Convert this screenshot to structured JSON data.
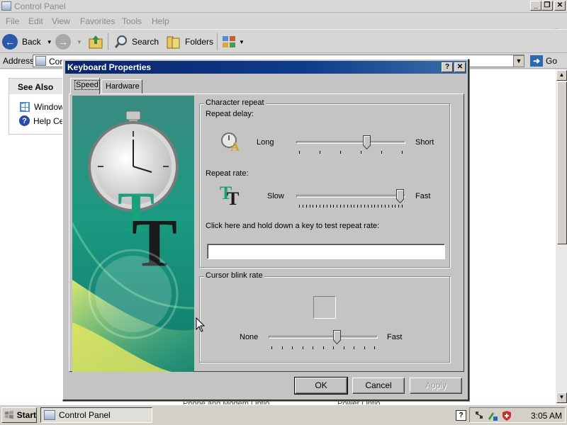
{
  "control_panel": {
    "title": "Control Panel",
    "menu": [
      "File",
      "Edit",
      "View",
      "Favorites",
      "Tools",
      "Help"
    ],
    "toolbar": {
      "back": "Back",
      "search": "Search",
      "folders": "Folders"
    },
    "address": {
      "label": "Address",
      "value": "Con",
      "go": "Go"
    },
    "see_also": {
      "title": "See Also",
      "links": [
        "Windows",
        "Help Cen"
      ]
    },
    "background_items": [
      "Phone and Modem Optio",
      "Power Optio"
    ]
  },
  "dialog": {
    "title": "Keyboard Properties",
    "tabs": [
      "Speed",
      "Hardware"
    ],
    "character_repeat": {
      "legend": "Character repeat",
      "repeat_delay": {
        "label": "Repeat delay:",
        "min_label": "Long",
        "max_label": "Short",
        "value_fraction": 0.66
      },
      "repeat_rate": {
        "label": "Repeat rate:",
        "min_label": "Slow",
        "max_label": "Fast",
        "value_fraction": 1.0
      },
      "test_label": "Click here and hold down a key to test repeat rate:",
      "test_value": ""
    },
    "cursor_blink": {
      "legend": "Cursor blink rate",
      "min_label": "None",
      "max_label": "Fast",
      "value_fraction": 0.64
    },
    "buttons": {
      "ok": "OK",
      "cancel": "Cancel",
      "apply": "Apply"
    }
  },
  "taskbar": {
    "start": "Start",
    "active_task": "Control Panel",
    "clock": "3:05 AM"
  },
  "colors": {
    "dialog_title_start": "#0a246a",
    "dialog_title_end": "#3a6ea5",
    "dialog_face": "#c4c4c4",
    "teal_accent": "#1a9a80"
  }
}
